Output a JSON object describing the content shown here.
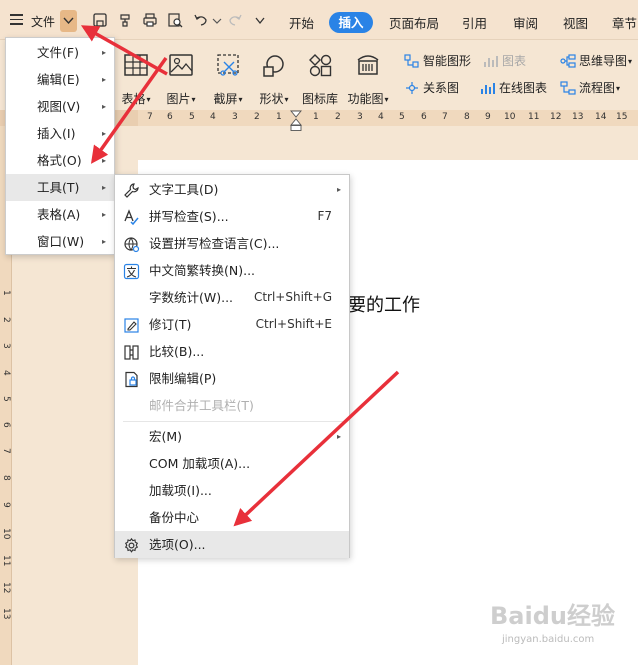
{
  "menubar": {
    "file_label": "文件",
    "tabs": [
      "开始",
      "插入",
      "页面布局",
      "引用",
      "审阅",
      "视图",
      "章节"
    ],
    "active_tab": "插入"
  },
  "ribbon": {
    "big": [
      "表格",
      "图片",
      "截屏",
      "形状",
      "图标库",
      "功能图"
    ],
    "small": {
      "smart_shape": "智能图形",
      "chart": "图表",
      "mind_map": "思维导图",
      "relation": "关系图",
      "online_chart": "在线图表",
      "flowchart": "流程图"
    }
  },
  "ruler": {
    "h": [
      "7",
      "6",
      "5",
      "4",
      "3",
      "2",
      "1",
      "1",
      "2",
      "3",
      "4",
      "5",
      "6",
      "7",
      "8",
      "9",
      "10",
      "11",
      "12",
      "13",
      "14",
      "15"
    ],
    "v": [
      "1",
      "2",
      "3",
      "4",
      "5",
      "6",
      "7",
      "8",
      "9",
      "10",
      "11",
      "12",
      "13"
    ]
  },
  "document": {
    "text": "要的工作"
  },
  "menu_main": {
    "items": [
      {
        "label": "文件(F)",
        "arrow": "▸"
      },
      {
        "label": "编辑(E)",
        "arrow": "▸"
      },
      {
        "label": "视图(V)",
        "arrow": "▸"
      },
      {
        "label": "插入(I)",
        "arrow": "▸"
      },
      {
        "label": "格式(O)",
        "arrow": "▸"
      },
      {
        "label": "工具(T)",
        "arrow": "▸"
      },
      {
        "label": "表格(A)",
        "arrow": "▸"
      },
      {
        "label": "窗口(W)",
        "arrow": "▸"
      }
    ],
    "highlighted": "工具(T)"
  },
  "menu_tools": {
    "items": [
      {
        "label": "文字工具(D)",
        "shortcut": "",
        "arrow": "▸"
      },
      {
        "label": "拼写检查(S)...",
        "shortcut": "F7",
        "arrow": ""
      },
      {
        "label": "设置拼写检查语言(C)...",
        "shortcut": "",
        "arrow": ""
      },
      {
        "label": "中文简繁转换(N)...",
        "shortcut": "",
        "arrow": ""
      },
      {
        "label": "字数统计(W)...",
        "shortcut": "Ctrl+Shift+G",
        "arrow": ""
      },
      {
        "label": "修订(T)",
        "shortcut": "Ctrl+Shift+E",
        "arrow": ""
      },
      {
        "label": "比较(B)...",
        "shortcut": "",
        "arrow": ""
      },
      {
        "label": "限制编辑(P)",
        "shortcut": "",
        "arrow": ""
      },
      {
        "label": "邮件合并工具栏(T)",
        "shortcut": "",
        "arrow": ""
      },
      {
        "label": "宏(M)",
        "shortcut": "",
        "arrow": "▸"
      },
      {
        "label": "COM 加载项(A)...",
        "shortcut": "",
        "arrow": ""
      },
      {
        "label": "加载项(I)...",
        "shortcut": "",
        "arrow": ""
      },
      {
        "label": "备份中心",
        "shortcut": "",
        "arrow": ""
      },
      {
        "label": "选项(O)...",
        "shortcut": "",
        "arrow": ""
      }
    ],
    "highlighted": "选项(O)..."
  },
  "watermark": {
    "brand": "Baidu经验",
    "sub": "jingyan.baidu.com"
  },
  "colors": {
    "accent": "#2a83e6",
    "arrow": "#e8303a",
    "ribbon_bg": "#f5e6d3",
    "doc_bg": "#ffffff"
  }
}
